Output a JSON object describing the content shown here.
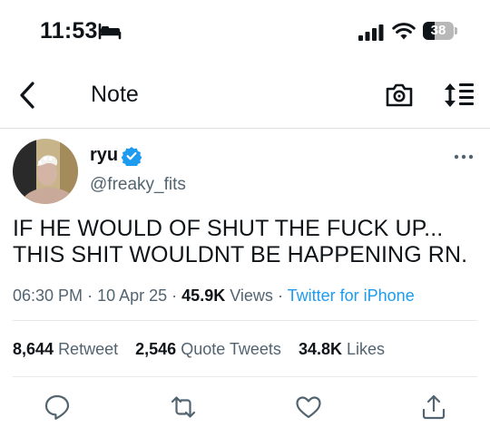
{
  "status_bar": {
    "time": "11:53",
    "battery_text": "38",
    "battery_level": 0.38,
    "icons": [
      "bed-icon",
      "cellular-signal-icon",
      "wifi-icon",
      "battery-icon"
    ]
  },
  "nav": {
    "title": "Note",
    "icons": [
      "back-chevron-icon",
      "camera-icon",
      "sort-icon"
    ]
  },
  "tweet": {
    "display_name": "ryu",
    "handle": "@freaky_fits",
    "text_lines": [
      "IF HE WOULD OF SHUT THE FUCK UP...",
      "THIS SHIT WOULDNT BE HAPPENING RN."
    ],
    "time": "06:30 PM",
    "date": "10 Apr 25",
    "views_count": "45.9K",
    "views_label": "Views",
    "source": "Twitter for iPhone",
    "sep": "·",
    "retweets": "8,644",
    "retweets_label": "Retweet",
    "quote_tweets": "2,546",
    "quote_tweets_label": "Quote Tweets",
    "likes": "34.8K",
    "likes_label": "Likes"
  },
  "actions": [
    "reply-icon",
    "retweet-icon",
    "like-icon",
    "share-icon"
  ],
  "colors": {
    "accent": "#1d9bf0",
    "text": "#0f1419",
    "secondary": "#536471",
    "divider": "#e6e9ec"
  }
}
